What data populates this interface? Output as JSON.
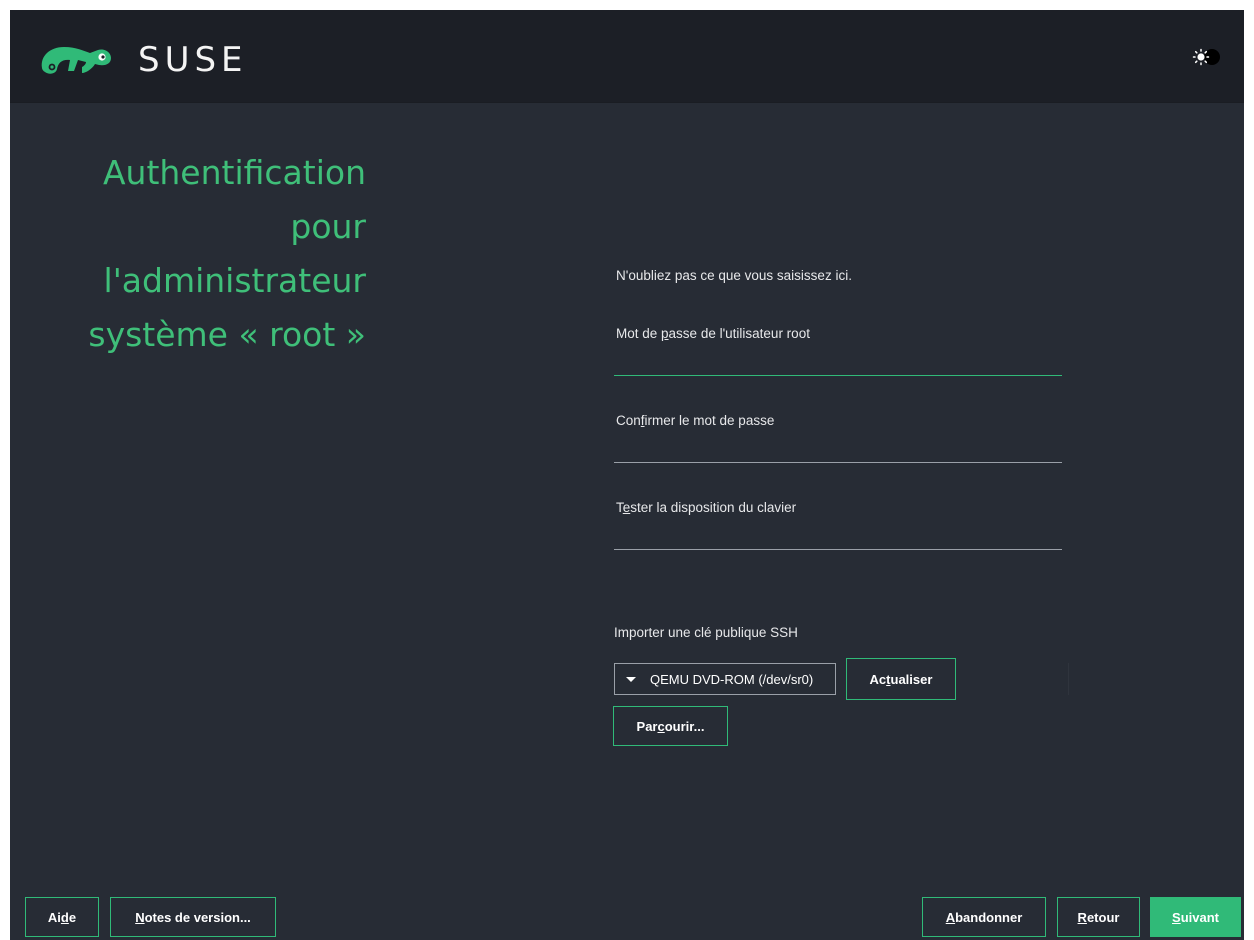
{
  "header": {
    "brand": "SUSE",
    "logo_icon": "chameleon-logo-icon",
    "theme_toggle_icon": "theme-toggle-icon"
  },
  "title_lines": [
    "Authentification",
    "pour",
    "l'administrateur",
    "système « root »"
  ],
  "hint": "N'oubliez pas ce que vous saisissez ici.",
  "fields": {
    "root_password": {
      "label_pre": "Mot de ",
      "label_key": "p",
      "label_post": "asse de l'utilisateur root",
      "value": ""
    },
    "confirm_password": {
      "label_pre": "Con",
      "label_key": "f",
      "label_post": "irmer le mot de passe",
      "value": ""
    },
    "test_keyboard": {
      "label_pre": "T",
      "label_key": "e",
      "label_post": "ster la disposition du clavier",
      "value": ""
    }
  },
  "ssh": {
    "label": "Importer une clé publique SSH",
    "device": "QEMU  DVD-ROM (/dev/sr0)",
    "refresh_pre": "Ac",
    "refresh_key": "t",
    "refresh_post": "ualiser",
    "browse_pre": "Par",
    "browse_key": "c",
    "browse_post": "ourir..."
  },
  "footer": {
    "help_pre": "Ai",
    "help_key": "d",
    "help_post": "e",
    "release_notes_key": "N",
    "release_notes_post": "otes de version...",
    "abort_key": "A",
    "abort_post": "bandonner",
    "back_key": "R",
    "back_post": "etour",
    "next_key": "S",
    "next_post": "uivant"
  },
  "colors": {
    "accent": "#30ba78",
    "heading": "#3fbf79",
    "background": "#272c35",
    "topbar": "#1c1f26"
  }
}
